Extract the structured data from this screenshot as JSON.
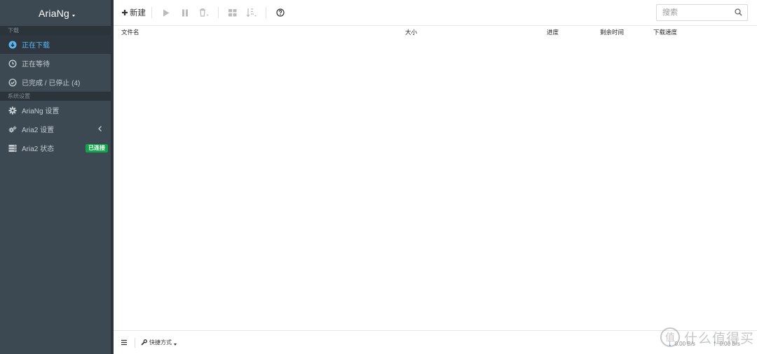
{
  "brand": {
    "title": "AriaNg"
  },
  "sidebar": {
    "section_download": "下载",
    "section_settings": "系统设置",
    "items": [
      {
        "label": "正在下载",
        "icon": "download-circle-icon"
      },
      {
        "label": "正在等待",
        "icon": "clock-icon"
      },
      {
        "label": "已完成 / 已停止 (4)",
        "icon": "check-circle-icon"
      },
      {
        "label": "AriaNg 设置",
        "icon": "gear-icon"
      },
      {
        "label": "Aria2 设置",
        "icon": "gears-icon"
      },
      {
        "label": "Aria2 状态",
        "icon": "server-icon",
        "badge": "已连接"
      }
    ]
  },
  "toolbar": {
    "new_label": "新建",
    "search_placeholder": "搜索"
  },
  "table": {
    "headers": [
      "文件名",
      "大小",
      "进度",
      "剩余时间",
      "下载速度"
    ]
  },
  "footer": {
    "shortcut_label": "快捷方式",
    "download_speed": "0.00 B/s",
    "upload_speed": "0.00 B/s"
  },
  "watermark": {
    "text": "什么值得买",
    "logo": "值"
  },
  "colors": {
    "sidebar_bg": "#3c4852",
    "active_text": "#5ab7f2",
    "badge_bg": "#11a44a"
  }
}
